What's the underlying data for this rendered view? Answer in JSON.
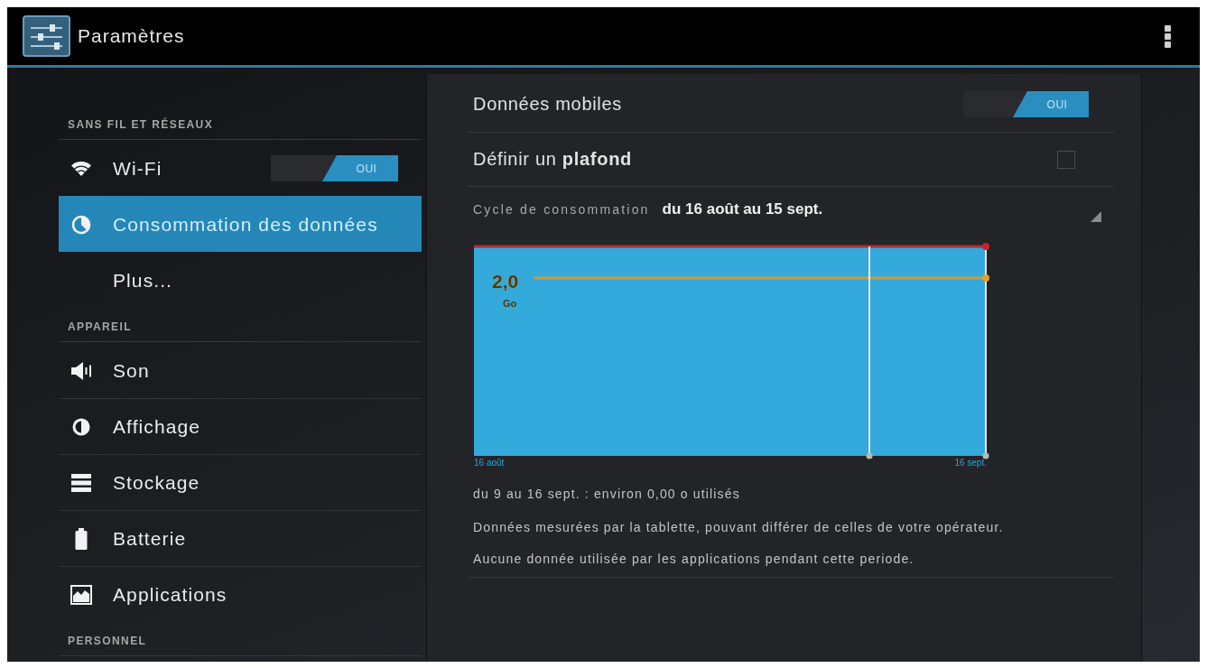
{
  "action_bar": {
    "title": "Paramètres"
  },
  "sidebar": {
    "items": [
      {
        "kind": "header",
        "label": "SANS FIL ET RÉSEAUX"
      },
      {
        "kind": "entry",
        "label": "Wi-Fi",
        "selected": false,
        "toggle": {
          "label": "OUI",
          "on": true
        }
      },
      {
        "kind": "entry",
        "label": "Consommation des données",
        "selected": true
      },
      {
        "kind": "entry",
        "label": "Plus...",
        "selected": false
      },
      {
        "kind": "header",
        "label": "APPAREIL"
      },
      {
        "kind": "entry",
        "label": "Son",
        "selected": false
      },
      {
        "kind": "entry",
        "label": "Affichage",
        "selected": false
      },
      {
        "kind": "entry",
        "label": "Stockage",
        "selected": false
      },
      {
        "kind": "entry",
        "label": "Batterie",
        "selected": false
      },
      {
        "kind": "entry",
        "label": "Applications",
        "selected": false
      },
      {
        "kind": "header",
        "label": "PERSONNEL"
      }
    ]
  },
  "detail": {
    "mobile_data": {
      "label": "Données mobiles",
      "toggle": {
        "label": "OUI",
        "on": true
      }
    },
    "set_limit": {
      "label": "Définir un **plafond**",
      "checked": false
    },
    "cycle": {
      "label": "Cycle de consommation",
      "value": "du 16 août au 15 sept."
    },
    "chart": {
      "warning_value": "2,0",
      "warning_unit": "Go",
      "start_label": "16 août",
      "end_label": "16 sept."
    },
    "summary": "du 9 au 16 sept. : environ 0,00 o utilisés",
    "notes": [
      "Données mesurées par la tablette, pouvant différer de celles de votre opérateur.",
      "Aucune donnée utilisée par les applications pendant cette periode."
    ]
  }
}
